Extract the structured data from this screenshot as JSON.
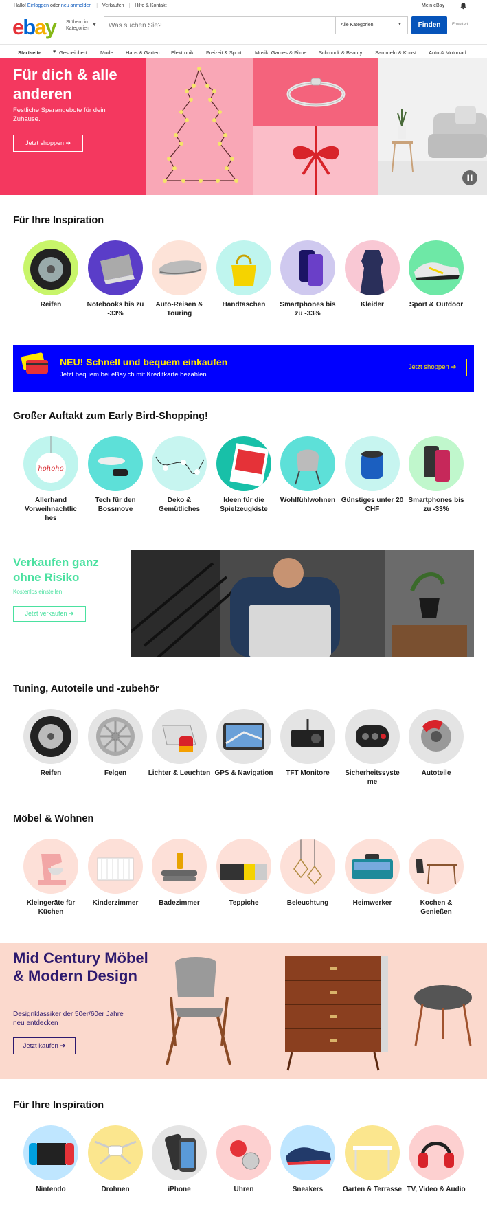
{
  "topbar": {
    "greeting": "Hallo!",
    "login": "Einloggen",
    "or": "oder",
    "register": "neu anmelden",
    "sell": "Verkaufen",
    "help": "Hilfe & Kontakt",
    "my_ebay": "Mein eBay"
  },
  "header": {
    "shop_by": "Stöbern in Kategorien",
    "search_placeholder": "Was suchen Sie?",
    "category": "Alle Kategorien",
    "find": "Finden",
    "advanced": "Erweitert"
  },
  "nav": [
    "Startseite",
    "Gespeichert",
    "Mode",
    "Haus & Garten",
    "Elektronik",
    "Freizeit & Sport",
    "Musik, Games & Filme",
    "Schmuck & Beauty",
    "Sammeln & Kunst",
    "Auto & Motorrad"
  ],
  "hero": {
    "title": "Für dich & alle anderen",
    "subtitle": "Festliche Sparangebote für dein Zuhause.",
    "button": "Jetzt shoppen ➔"
  },
  "sections": {
    "inspiration1": {
      "title": "Für Ihre Inspiration",
      "items": [
        "Reifen",
        "Notebooks bis zu -33%",
        "Auto-Reisen & Touring",
        "Handtaschen",
        "Smartphones bis zu -33%",
        "Kleider",
        "Sport & Outdoor"
      ]
    },
    "earlybird": {
      "title": "Großer Auftakt zum Early Bird-Shopping!",
      "items": [
        "Allerhand Vorweihnachtlic hes",
        "Tech für den Bossmove",
        "Deko & Gemütliches",
        "Ideen für die Spielzeugkiste",
        "Wohlfühlwohnen",
        "Günstiges unter 20 CHF",
        "Smartphones bis zu -33%"
      ]
    },
    "tuning": {
      "title": "Tuning, Autoteile und -zubehör",
      "items": [
        "Reifen",
        "Felgen",
        "Lichter & Leuchten",
        "GPS & Navigation",
        "TFT Monitore",
        "Sicherheitssyste me",
        "Autoteile"
      ]
    },
    "moebel": {
      "title": "Möbel & Wohnen",
      "items": [
        "Kleingeräte für Küchen",
        "Kinderzimmer",
        "Badezimmer",
        "Teppiche",
        "Beleuchtung",
        "Heimwerker",
        "Kochen & Genießen"
      ]
    },
    "inspiration2": {
      "title": "Für Ihre Inspiration",
      "items": [
        "Nintendo",
        "Drohnen",
        "iPhone",
        "Uhren",
        "Sneakers",
        "Garten & Terrasse",
        "TV, Video & Audio"
      ]
    }
  },
  "pay_banner": {
    "title": "NEU! Schnell und bequem einkaufen",
    "subtitle": "Jetzt bequem bei eBay.ch mit Kreditkarte bezahlen",
    "button": "Jetzt shoppen ➔"
  },
  "sell": {
    "title": "Verkaufen ganz ohne Risiko",
    "subtitle": "Kostenlos einstellen",
    "button": "Jetzt verkaufen ➔"
  },
  "mid_century": {
    "title": "Mid Century Möbel & Modern Design",
    "subtitle": "Designklassiker der 50er/60er Jahre neu entdecken",
    "button": "Jetzt kaufen ➔"
  },
  "colors": {
    "ebay_red": "#e53238",
    "ebay_blue": "#0064d2",
    "ebay_yellow": "#f5af02",
    "ebay_green": "#86b817",
    "hero_red": "#f4385f",
    "pay_blue": "#0000ff",
    "sell_green": "#4be1a0",
    "mc_pink": "#fbd9cd",
    "mc_purple": "#2e1a6e"
  }
}
